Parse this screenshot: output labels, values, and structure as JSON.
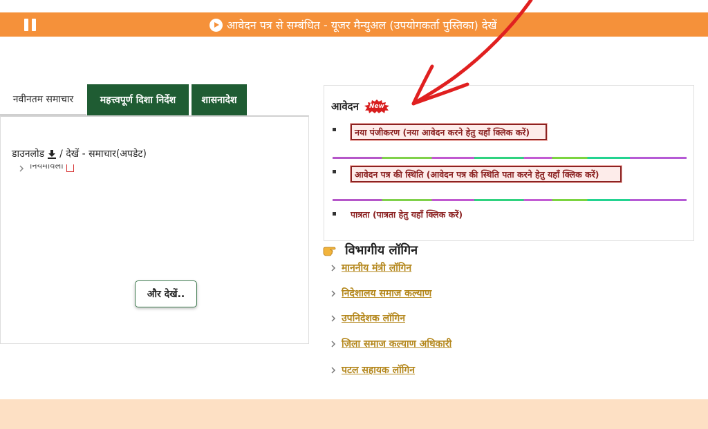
{
  "banner": {
    "marquee_text": "आवेदन पत्र से सम्बंधित - यूजर मैन्युअल (उपयोगकर्ता पुस्तिका) देखें"
  },
  "tabs": [
    {
      "label": "नवीनतम समाचार"
    },
    {
      "label": "महत्त्वपूर्ण दिशा निर्देश"
    },
    {
      "label": "शासनादेश"
    }
  ],
  "news": {
    "heading_pre": "डाउनलोड",
    "heading_post": "/ देखें - समाचार(अपडेट)",
    "items": [
      "नियमावली"
    ],
    "more_button": "और देखें.."
  },
  "application": {
    "title": "आवेदन",
    "badge": "New",
    "links": [
      "नया पंजीकरण (नया आवेदन करने हेतु यहाँ क्लिक करें)",
      "आवेदन पत्र की स्थिति (आवेदन पत्र की स्थिति पता करने हेतु यहाँ क्लिक करें)",
      "पात्रता (पात्रता हेतु यहाँ क्लिक करें)"
    ]
  },
  "department_login": {
    "heading": "विभागीय लॉगिन",
    "items": [
      "माननीय मंत्री लॉगिन",
      "निदेशालय समाज कल्याण",
      "उपनिदेशक लॉगिन",
      "ज़िला समाज कल्याण अधिकारी",
      "पटल सहायक लॉगिन"
    ]
  },
  "colors": {
    "banner": "#f5913a",
    "tab_active": "#1f5c33",
    "link_red": "#8b2222",
    "dept_link": "#b4871c",
    "footer": "#fde0c4",
    "annotation_arrow": "#e02020"
  },
  "icons": [
    "pause-icon",
    "play-icon",
    "download-icon",
    "pdf-icon",
    "new-badge-icon",
    "pointing-hand-icon",
    "chevron-right-icon"
  ]
}
